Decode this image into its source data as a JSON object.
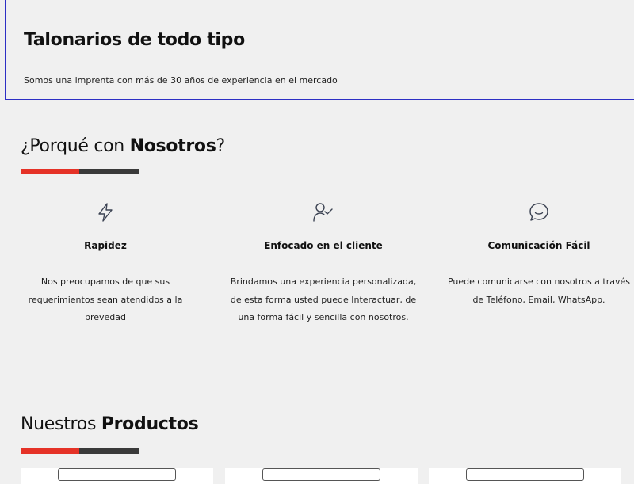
{
  "hero": {
    "title": "Talonarios de todo tipo",
    "subtitle": "Somos una imprenta con más de 30 años de experiencia en el mercado",
    "border_color": "#2d2fc4"
  },
  "why": {
    "heading_prefix": "¿Porqué con ",
    "heading_bold": "Nosotros",
    "heading_suffix": "?",
    "features": [
      {
        "icon": "lightning-icon",
        "title": "Rapidez",
        "description": "Nos preocupamos de que sus requerimientos sean atendidos a la brevedad"
      },
      {
        "icon": "user-check-icon",
        "title": "Enfocado en el cliente",
        "description": "Brindamos una experiencia personalizada, de esta forma usted puede Interactuar, de una forma fácil y sencilla con nosotros."
      },
      {
        "icon": "chat-bubble-icon",
        "title": "Comunicación Fácil",
        "description": "Puede comunicarse con nosotros a través de Teléfono, Email, WhatsApp."
      }
    ]
  },
  "products": {
    "heading_prefix": "Nuestros ",
    "heading_bold": "Productos"
  },
  "colors": {
    "accent_red": "#e53227",
    "accent_dark": "#3a3a3a",
    "background": "#f0f0f0"
  }
}
